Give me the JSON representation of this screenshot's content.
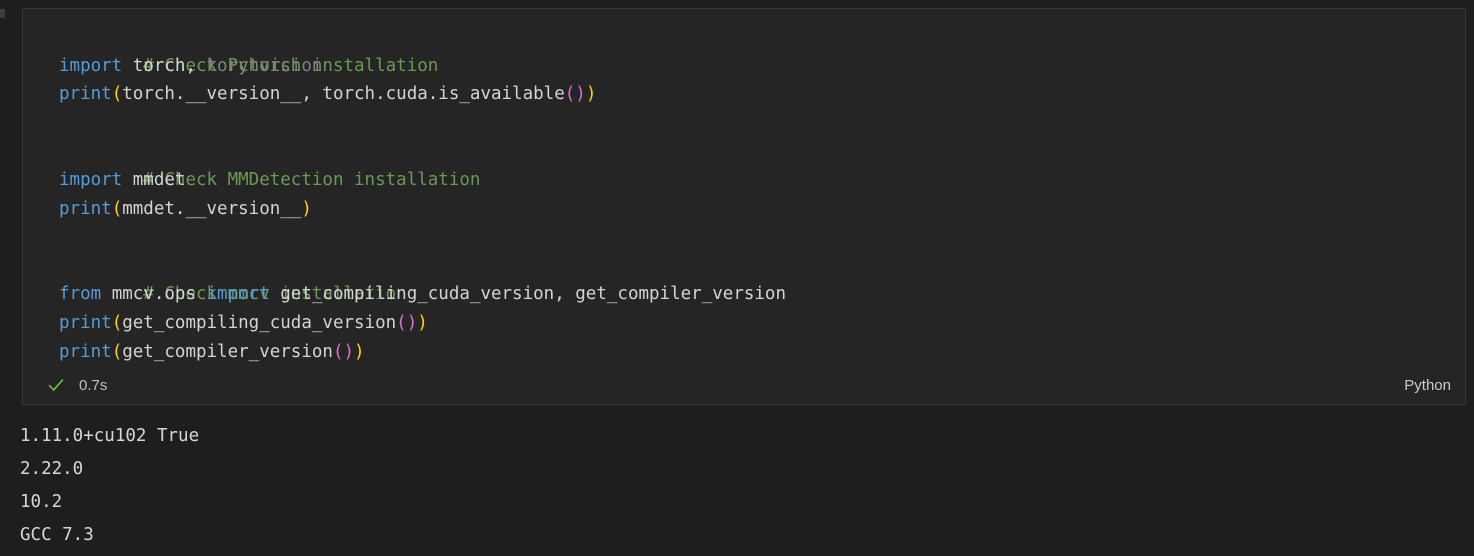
{
  "cell": {
    "language": "Python",
    "execution_time": "0.7s",
    "status_icon": "check-icon",
    "status": "succeeded",
    "code_lines": [
      {
        "id": "l1",
        "text": "# Check Pytorch installation"
      },
      {
        "id": "l2",
        "text": "import torch, torchvision"
      },
      {
        "id": "l3",
        "text": "print(torch.__version__, torch.cuda.is_available())"
      },
      {
        "id": "l4",
        "text": ""
      },
      {
        "id": "l5",
        "text": "# Check MMDetection installation"
      },
      {
        "id": "l6",
        "text": "import mmdet"
      },
      {
        "id": "l7",
        "text": "print(mmdet.__version__)"
      },
      {
        "id": "l8",
        "text": ""
      },
      {
        "id": "l9",
        "text": "# Check mmcv installation"
      },
      {
        "id": "l10",
        "text": "from mmcv.ops import get_compiling_cuda_version, get_compiler_version"
      },
      {
        "id": "l11",
        "text": "print(get_compiling_cuda_version())"
      },
      {
        "id": "l12",
        "text": "print(get_compiler_version())"
      }
    ]
  },
  "output": {
    "lines": [
      {
        "id": "o1",
        "text": "1.11.0+cu102 True"
      },
      {
        "id": "o2",
        "text": "2.22.0"
      },
      {
        "id": "o3",
        "text": "10.2"
      },
      {
        "id": "o4",
        "text": "GCC 7.3"
      }
    ]
  },
  "colors": {
    "editor_background": "#1e1e1e",
    "cell_background": "#252526",
    "cell_border": "#37373a",
    "comment": "#6a9955",
    "keyword": "#569cd6",
    "identifier": "#d4d4d4",
    "dimmed_identifier": "#808080",
    "bracket_level_1": "#ffd700",
    "bracket_level_2": "#da70d6",
    "success_check": "#6cc24a",
    "output_text": "#d7d7d7"
  }
}
